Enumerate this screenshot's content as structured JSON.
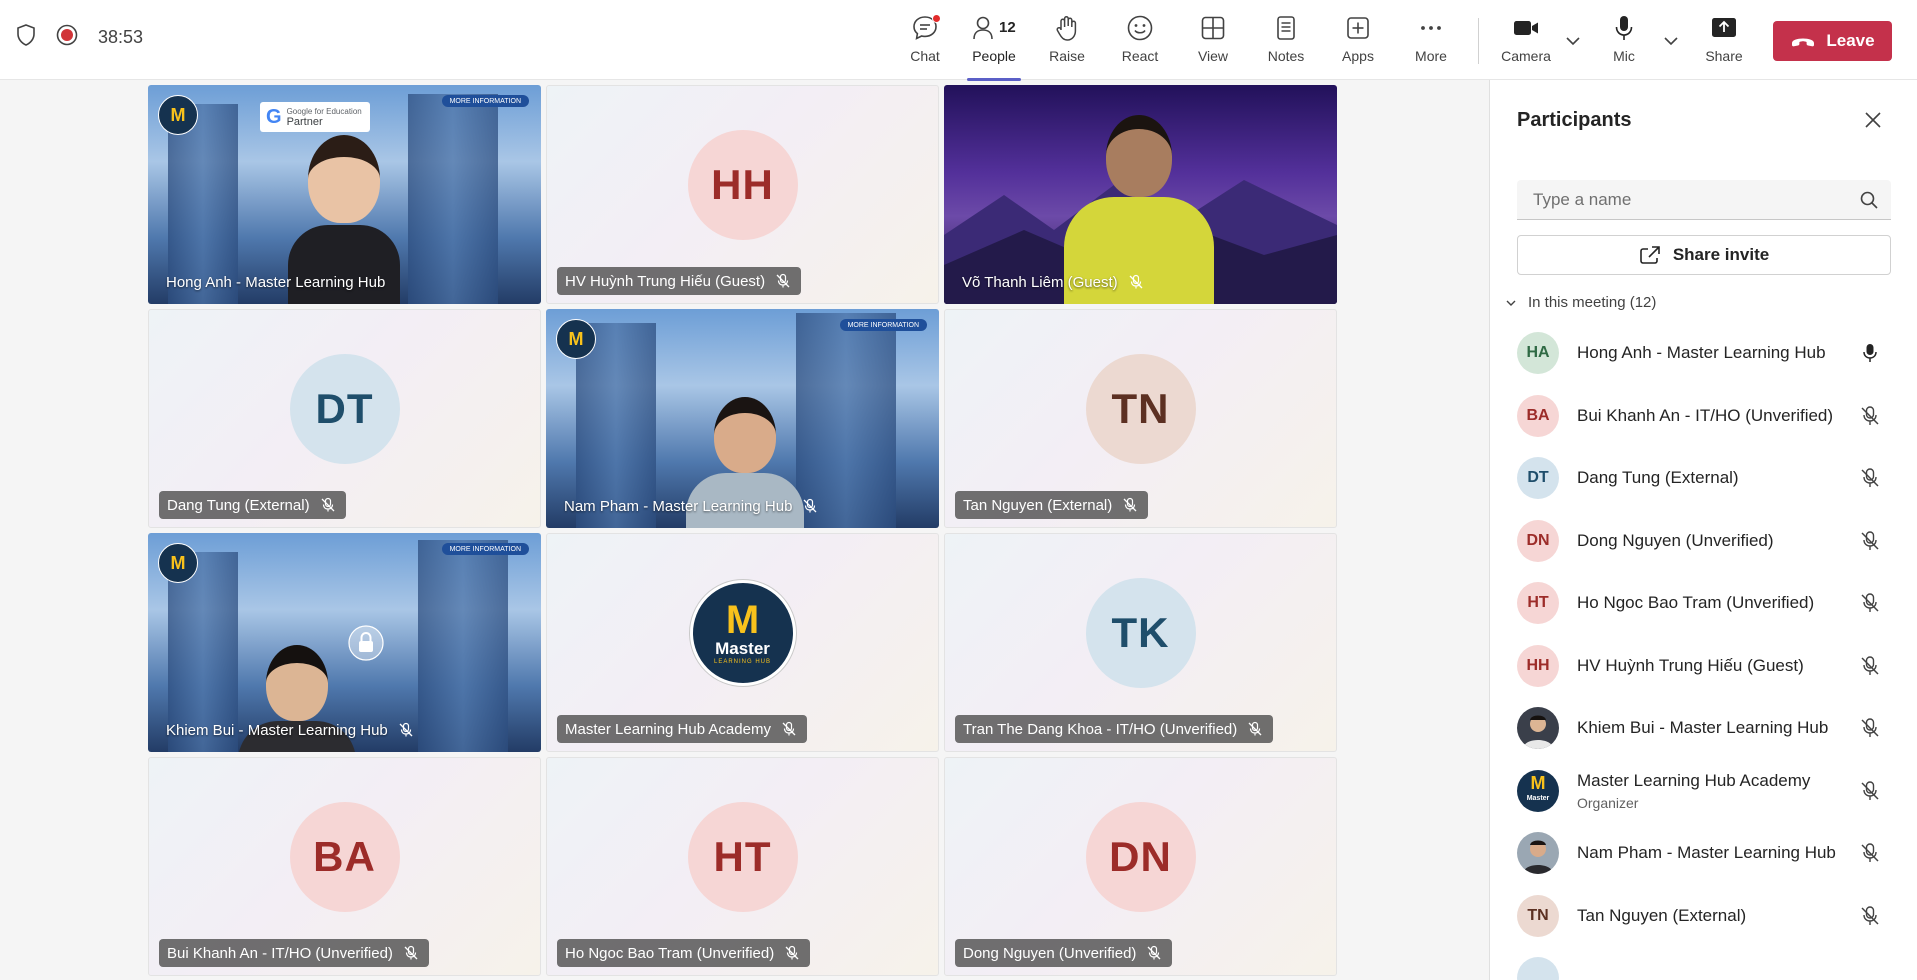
{
  "top_bar": {
    "timer": "38:53",
    "buttons": {
      "chat": "Chat",
      "people": "People",
      "people_count": "12",
      "raise": "Raise",
      "react": "React",
      "view": "View",
      "notes": "Notes",
      "apps": "Apps",
      "more": "More",
      "camera": "Camera",
      "mic": "Mic",
      "share": "Share"
    },
    "leave": "Leave"
  },
  "tiles": [
    {
      "name": "Hong Anh - Master Learning Hub",
      "initials": "",
      "kind": "video-building",
      "muted": false
    },
    {
      "name": "HV Huỳnh Trung Hiếu (Guest)",
      "initials": "HH",
      "kind": "avatar",
      "muted": true
    },
    {
      "name": "Võ Thanh Liêm (Guest)",
      "initials": "",
      "kind": "video-mountain",
      "muted": true
    },
    {
      "name": "Dang Tung (External)",
      "initials": "DT",
      "kind": "avatar",
      "muted": true
    },
    {
      "name": "Nam Pham - Master Learning Hub",
      "initials": "",
      "kind": "video-building",
      "muted": true
    },
    {
      "name": "Tan Nguyen (External)",
      "initials": "TN",
      "kind": "avatar",
      "muted": true
    },
    {
      "name": "Khiem Bui - Master Learning Hub",
      "initials": "",
      "kind": "video-building",
      "muted": true
    },
    {
      "name": "Master Learning Hub Academy",
      "initials": "",
      "kind": "logo",
      "muted": true
    },
    {
      "name": "Tran The Dang Khoa - IT/HO (Unverified)",
      "initials": "TK",
      "kind": "avatar",
      "muted": true
    },
    {
      "name": "Bui Khanh An - IT/HO (Unverified)",
      "initials": "BA",
      "kind": "avatar",
      "muted": true
    },
    {
      "name": "Ho Ngoc Bao Tram (Unverified)",
      "initials": "HT",
      "kind": "avatar",
      "muted": true
    },
    {
      "name": "Dong Nguyen (Unverified)",
      "initials": "DN",
      "kind": "avatar",
      "muted": true
    }
  ],
  "video_overlay": {
    "more_info": "MORE INFORMATION",
    "google_line1": "Google for Education",
    "google_line2": "Partner",
    "logo_m": "M",
    "logo_word": "Master",
    "logo_sub": "LEARNING HUB"
  },
  "participants_panel": {
    "title": "Participants",
    "search_placeholder": "Type a name",
    "share_invite": "Share invite",
    "section": "In this meeting (12)",
    "items": [
      {
        "initials": "HA",
        "name": "Hong Anh - Master Learning Hub",
        "sub": "",
        "mic": "on"
      },
      {
        "initials": "BA",
        "name": "Bui Khanh An - IT/HO (Unverified)",
        "sub": "",
        "mic": "off"
      },
      {
        "initials": "DT",
        "name": "Dang Tung (External)",
        "sub": "",
        "mic": "off"
      },
      {
        "initials": "DN",
        "name": "Dong Nguyen (Unverified)",
        "sub": "",
        "mic": "off"
      },
      {
        "initials": "HT",
        "name": "Ho Ngoc Bao Tram (Unverified)",
        "sub": "",
        "mic": "off"
      },
      {
        "initials": "HH",
        "name": "HV Huỳnh Trung Hiếu (Guest)",
        "sub": "",
        "mic": "off"
      },
      {
        "initials": "",
        "name": "Khiem Bui - Master Learning Hub",
        "sub": "",
        "mic": "off"
      },
      {
        "initials": "",
        "name": "Master Learning Hub Academy",
        "sub": "Organizer",
        "mic": "off"
      },
      {
        "initials": "",
        "name": "Nam Pham - Master Learning Hub",
        "sub": "",
        "mic": "off"
      },
      {
        "initials": "TN",
        "name": "Tan Nguyen (External)",
        "sub": "",
        "mic": "off"
      }
    ]
  },
  "colors": {
    "accent": "#5b5fc7",
    "leave_red": "#c4314b",
    "avatar_pink_bg": "#f6d6d5",
    "avatar_pink_fg": "#9c2c29",
    "avatar_blue_bg": "#d4e3ed",
    "avatar_blue_fg": "#1f4e6b",
    "avatar_tan_bg": "#ecd9d1",
    "avatar_tan_fg": "#5c3022",
    "avatar_green_bg": "#d3e6d8",
    "avatar_green_fg": "#2f6a44",
    "logo_navy": "#15324f",
    "logo_yellow": "#f8c21c"
  }
}
